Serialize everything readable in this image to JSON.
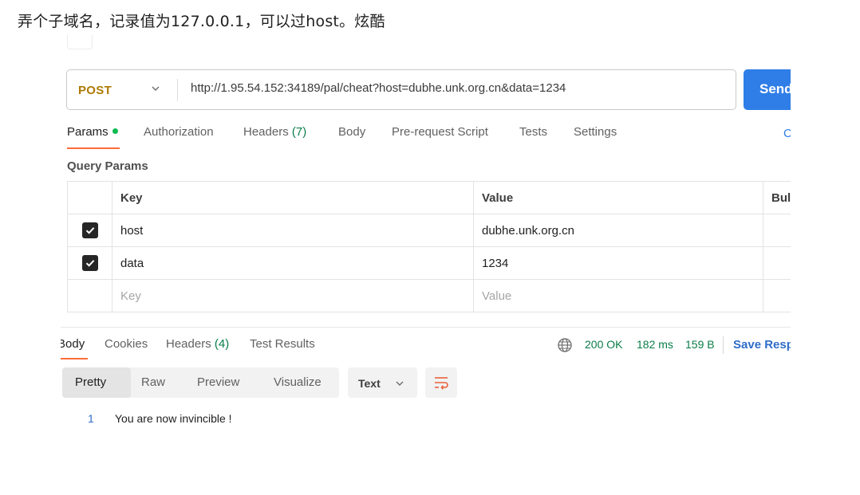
{
  "caption": "弄个子域名，记录值为127.0.0.1，可以过host。炫酷",
  "request": {
    "method": "POST",
    "url": "http://1.95.54.152:34189/pal/cheat?host=dubhe.unk.org.cn&data=1234",
    "send_label": "Send"
  },
  "request_tabs": [
    {
      "label": "Params"
    },
    {
      "label": "Authorization"
    },
    {
      "label": "Headers",
      "count": "(7)"
    },
    {
      "label": "Body"
    },
    {
      "label": "Pre-request Script"
    },
    {
      "label": "Tests"
    },
    {
      "label": "Settings"
    }
  ],
  "cookies_stub": "C",
  "query_params": {
    "title": "Query Params",
    "columns": [
      "Key",
      "Value",
      "Bul"
    ],
    "rows": [
      {
        "key": "host",
        "value": "dubhe.unk.org.cn",
        "checked": true
      },
      {
        "key": "data",
        "value": "1234",
        "checked": true
      }
    ],
    "placeholder": {
      "key": "Key",
      "value": "Value"
    }
  },
  "response_tabs": [
    {
      "label": "Body"
    },
    {
      "label": "Cookies"
    },
    {
      "label": "Headers",
      "count": "(4)"
    },
    {
      "label": "Test Results"
    }
  ],
  "response_status": {
    "code": "200 OK",
    "time": "182 ms",
    "size": "159 B",
    "save_label": "Save Resp"
  },
  "view_modes": [
    "Pretty",
    "Raw",
    "Preview",
    "Visualize"
  ],
  "format": "Text",
  "response_body": {
    "line_number": "1",
    "text": "You are now invincible !"
  },
  "colors": {
    "accent": "#ff6c37",
    "send": "#2f7ee8",
    "method": "#ad7a03",
    "status_ok": "#0a7d49"
  },
  "icons": [
    "chevron-down-icon",
    "checkbox-checked-icon",
    "globe-icon",
    "wrap-lines-icon"
  ]
}
